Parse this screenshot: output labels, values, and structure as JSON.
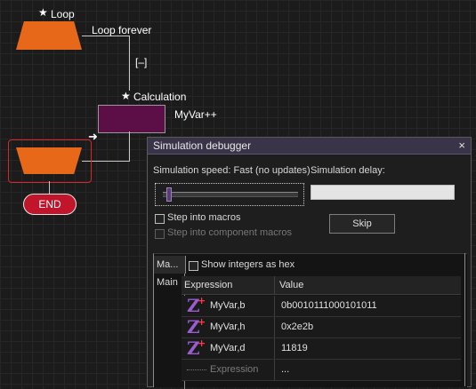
{
  "flowchart": {
    "loop_label": "Loop",
    "loop_forever_label": "Loop forever",
    "collapse_marker": "[–]",
    "calculation_label": "Calculation",
    "calc_expression": "MyVar++",
    "end_label": "END",
    "star_glyph": "★",
    "arrow_glyph": "➜"
  },
  "debugger": {
    "title": "Simulation debugger",
    "close_glyph": "×",
    "speed_label": "Simulation speed: Fast (no updates)",
    "speed_fraction": 0.03,
    "delay_label": "Simulation delay:",
    "step_into_macros_label": "Step into macros",
    "step_into_component_macros_label": "Step into component macros",
    "skip_label": "Skip",
    "tabs": [
      "Ma...",
      "Main"
    ],
    "show_integers_hex_label": "Show integers as hex",
    "columns": {
      "expression": "Expression",
      "value": "Value"
    },
    "rows": [
      {
        "expression": "MyVar,b",
        "value": "0b0010111000101011"
      },
      {
        "expression": "MyVar,h",
        "value": "0x2e2b"
      },
      {
        "expression": "MyVar,d",
        "value": "11819"
      }
    ],
    "new_row": {
      "expression": "Expression",
      "value": "..."
    },
    "z_glyph": "Z",
    "plus_glyph": "+"
  },
  "colors": {
    "flow_orange": "#e8681a",
    "calc_purple": "#5c0f46",
    "end_red": "#c0152a",
    "selection_red": "#d8262b",
    "titlebar": "#3a3448"
  }
}
